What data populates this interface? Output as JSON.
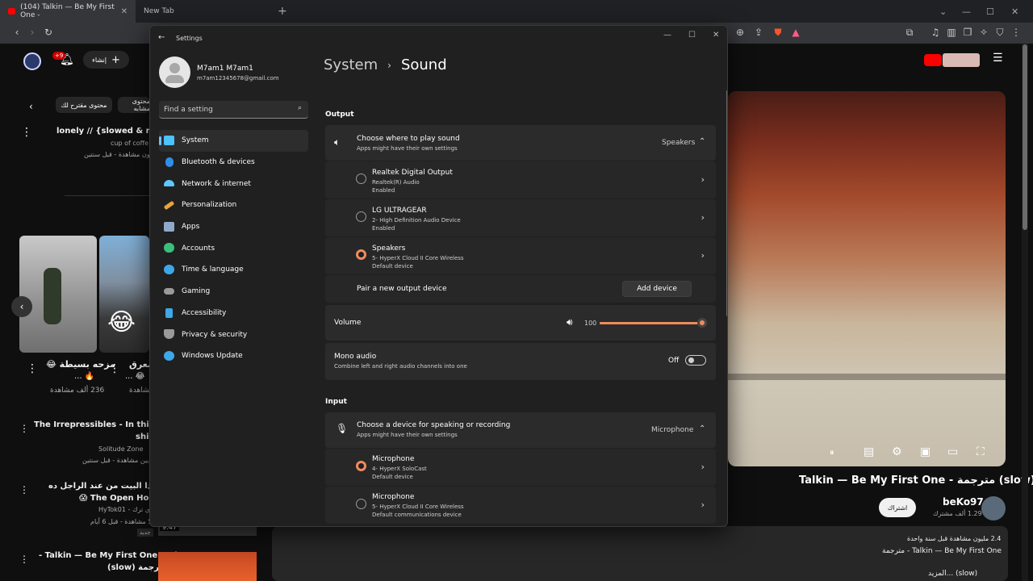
{
  "browser": {
    "tabs": [
      {
        "label": "(104) Talkin — Be My First One -"
      },
      {
        "label": "New Tab"
      }
    ]
  },
  "youtube": {
    "create_label": "إنشاء",
    "notif_count": "+9",
    "chips": [
      "محتوى مقترح لك",
      "محتوى مشابه"
    ],
    "top_video": {
      "title": "lonely // {slowed & reverb",
      "channel": "cup of coffe",
      "meta": "1 مليون مشاهدة - قبل سنتين"
    },
    "shorts": [
      {
        "title": "مزحه بسيطة 😂",
        "line2": "🔥 ...",
        "views": "236 ألف مشاهدة"
      },
      {
        "title": "معرق",
        "line2": "😂 ...",
        "views": "مشاهدة"
      }
    ],
    "list": [
      {
        "title": "The Irrepressibles - In this مترجمة",
        "title2": "shir",
        "channel": "Solitude Zone",
        "meta": "6 ملايين مشاهدة - قبل سنتين"
      },
      {
        "title": "!!! اشتري ذا البيت من عند الراجل ده",
        "title2": "😱 The Open Hous",
        "channel": "HyTok01 - أي ترك",
        "meta": "57 مشاهدة - قبل 6 أيام",
        "badge": "جديد",
        "duration": "9:47"
      },
      {
        "title": "- Talkin — Be My First One ميكس",
        "title2": "مترجمة (slow)",
        "channel": "",
        "meta": ""
      }
    ],
    "video_title": "Talkin — Be My First One - مترجمة (slow)",
    "channel_name": "beKo97",
    "subscribers": "1.29 ألف مشترك",
    "subscribe_label": "اشتراك",
    "desc_views": "2.4 مليون مشاهدة قبل سنة واحدة",
    "desc_title": "Talkin — Be My First One - مترجمة",
    "desc_more": "(slow) ...المزيد"
  },
  "settings": {
    "window_title": "Settings",
    "profile": {
      "name": "M7am1 M7am1",
      "email": "m7am12345678@gmail.com"
    },
    "search_placeholder": "Find a setting",
    "nav": [
      {
        "label": "System",
        "icon": "monitor-icon",
        "color": "#4cc2ff"
      },
      {
        "label": "Bluetooth & devices",
        "icon": "bluetooth-icon",
        "color": "#2f8fe8"
      },
      {
        "label": "Network & internet",
        "icon": "wifi-icon",
        "color": "#5cc8ff"
      },
      {
        "label": "Personalization",
        "icon": "brush-icon",
        "color": "#e8a33d"
      },
      {
        "label": "Apps",
        "icon": "apps-icon",
        "color": "#8fa9c9"
      },
      {
        "label": "Accounts",
        "icon": "person-icon",
        "color": "#39c07a"
      },
      {
        "label": "Time & language",
        "icon": "globe-clock-icon",
        "color": "#3ea7e8"
      },
      {
        "label": "Gaming",
        "icon": "controller-icon",
        "color": "#9a9a9a"
      },
      {
        "label": "Accessibility",
        "icon": "accessibility-icon",
        "color": "#3ea7e8"
      },
      {
        "label": "Privacy & security",
        "icon": "shield-icon",
        "color": "#9a9a9a"
      },
      {
        "label": "Windows Update",
        "icon": "update-icon",
        "color": "#3ea7e8"
      }
    ],
    "breadcrumb": {
      "parent": "System",
      "current": "Sound"
    },
    "output": {
      "section_label": "Output",
      "choose_title": "Choose where to play sound",
      "choose_sub": "Apps might have their own settings",
      "selected": "Speakers",
      "devices": [
        {
          "name": "Realtek Digital Output",
          "detail": "Realtek(R) Audio",
          "status": "Enabled",
          "selected": false
        },
        {
          "name": "LG ULTRAGEAR",
          "detail": "2- High Definition Audio Device",
          "status": "Enabled",
          "selected": false
        },
        {
          "name": "Speakers",
          "detail": "5- HyperX Cloud II Core Wireless",
          "status": "Default device",
          "selected": true
        }
      ],
      "pair_label": "Pair a new output device",
      "add_device_label": "Add device",
      "volume_label": "Volume",
      "volume_value": "100",
      "volume_level": 1.0,
      "mono_title": "Mono audio",
      "mono_sub": "Combine left and right audio channels into one",
      "mono_state": "Off"
    },
    "input": {
      "section_label": "Input",
      "choose_title": "Choose a device for speaking or recording",
      "choose_sub": "Apps might have their own settings",
      "selected": "Microphone",
      "devices": [
        {
          "name": "Microphone",
          "detail": "4- HyperX SoloCast",
          "status": "Default device",
          "selected": true
        },
        {
          "name": "Microphone",
          "detail": "5- HyperX Cloud II Core Wireless",
          "status": "Default communications device",
          "selected": false
        }
      ]
    },
    "accent": "#f08b5d"
  }
}
